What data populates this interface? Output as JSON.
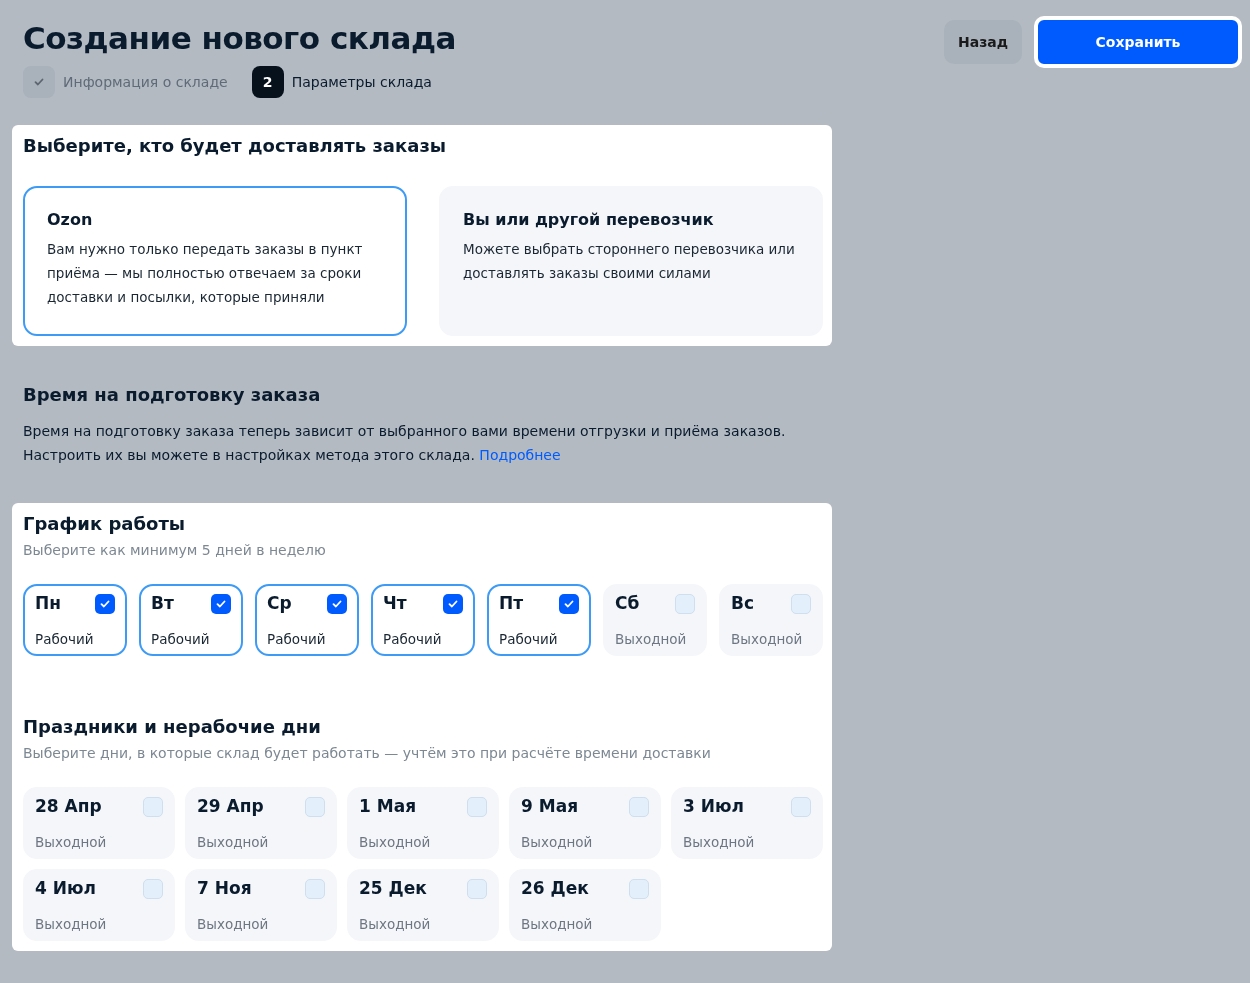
{
  "title": "Создание нового склада",
  "actions": [
    {
      "label": "Назад",
      "kind": "secondary"
    },
    {
      "label": "Сохранить",
      "kind": "primary"
    }
  ],
  "steps": [
    {
      "label": "Информация о складе",
      "done": true,
      "selected": false
    },
    {
      "label": "Параметры склада",
      "number": "2",
      "done": false,
      "selected": true
    }
  ],
  "delivery": {
    "title": "Выберите, кто будет доставлять заказы",
    "options": [
      {
        "title": "Ozon",
        "description": "Вам нужно только передать заказы в пункт приёма — мы полностью отвечаем за сроки доставки и посылки, которые приняли",
        "selected": true
      },
      {
        "title": "Вы или другой перевозчик",
        "description": "Можете выбрать стороннего перевозчика или доставлять заказы своими силами",
        "selected": false
      }
    ]
  },
  "preparation": {
    "title": "Время на подготовку заказа",
    "text": "Время на подготовку заказа теперь зависит от выбранного вами времени отгрузки и приёма заказов. Настроить их вы можете в настройках метода этого склада.",
    "link": "Подробнее"
  },
  "schedule": {
    "title": "График работы",
    "hint": "Выберите как минимум 5 дней в неделю",
    "days": [
      {
        "name": "Пн",
        "status": "Рабочий",
        "checked": true
      },
      {
        "name": "Вт",
        "status": "Рабочий",
        "checked": true
      },
      {
        "name": "Ср",
        "status": "Рабочий",
        "checked": true
      },
      {
        "name": "Чт",
        "status": "Рабочий",
        "checked": true
      },
      {
        "name": "Пт",
        "status": "Рабочий",
        "checked": true
      },
      {
        "name": "Сб",
        "status": "Выходной",
        "checked": false
      },
      {
        "name": "Вс",
        "status": "Выходной",
        "checked": false
      }
    ]
  },
  "holidays": {
    "title": "Праздники и нерабочие дни",
    "hint": "Выберите дни, в которые склад будет работать — учтём это при расчёте времени доставки",
    "days": [
      {
        "name": "28 Апр",
        "status": "Выходной",
        "checked": false
      },
      {
        "name": "29 Апр",
        "status": "Выходной",
        "checked": false
      },
      {
        "name": "1 Мая",
        "status": "Выходной",
        "checked": false
      },
      {
        "name": "9 Мая",
        "status": "Выходной",
        "checked": false
      },
      {
        "name": "3 Июл",
        "status": "Выходной",
        "checked": false
      },
      {
        "name": "4 Июл",
        "status": "Выходной",
        "checked": false
      },
      {
        "name": "7 Ноя",
        "status": "Выходной",
        "checked": false
      },
      {
        "name": "25 Дек",
        "status": "Выходной",
        "checked": false
      },
      {
        "name": "26 Дек",
        "status": "Выходной",
        "checked": false
      }
    ]
  }
}
